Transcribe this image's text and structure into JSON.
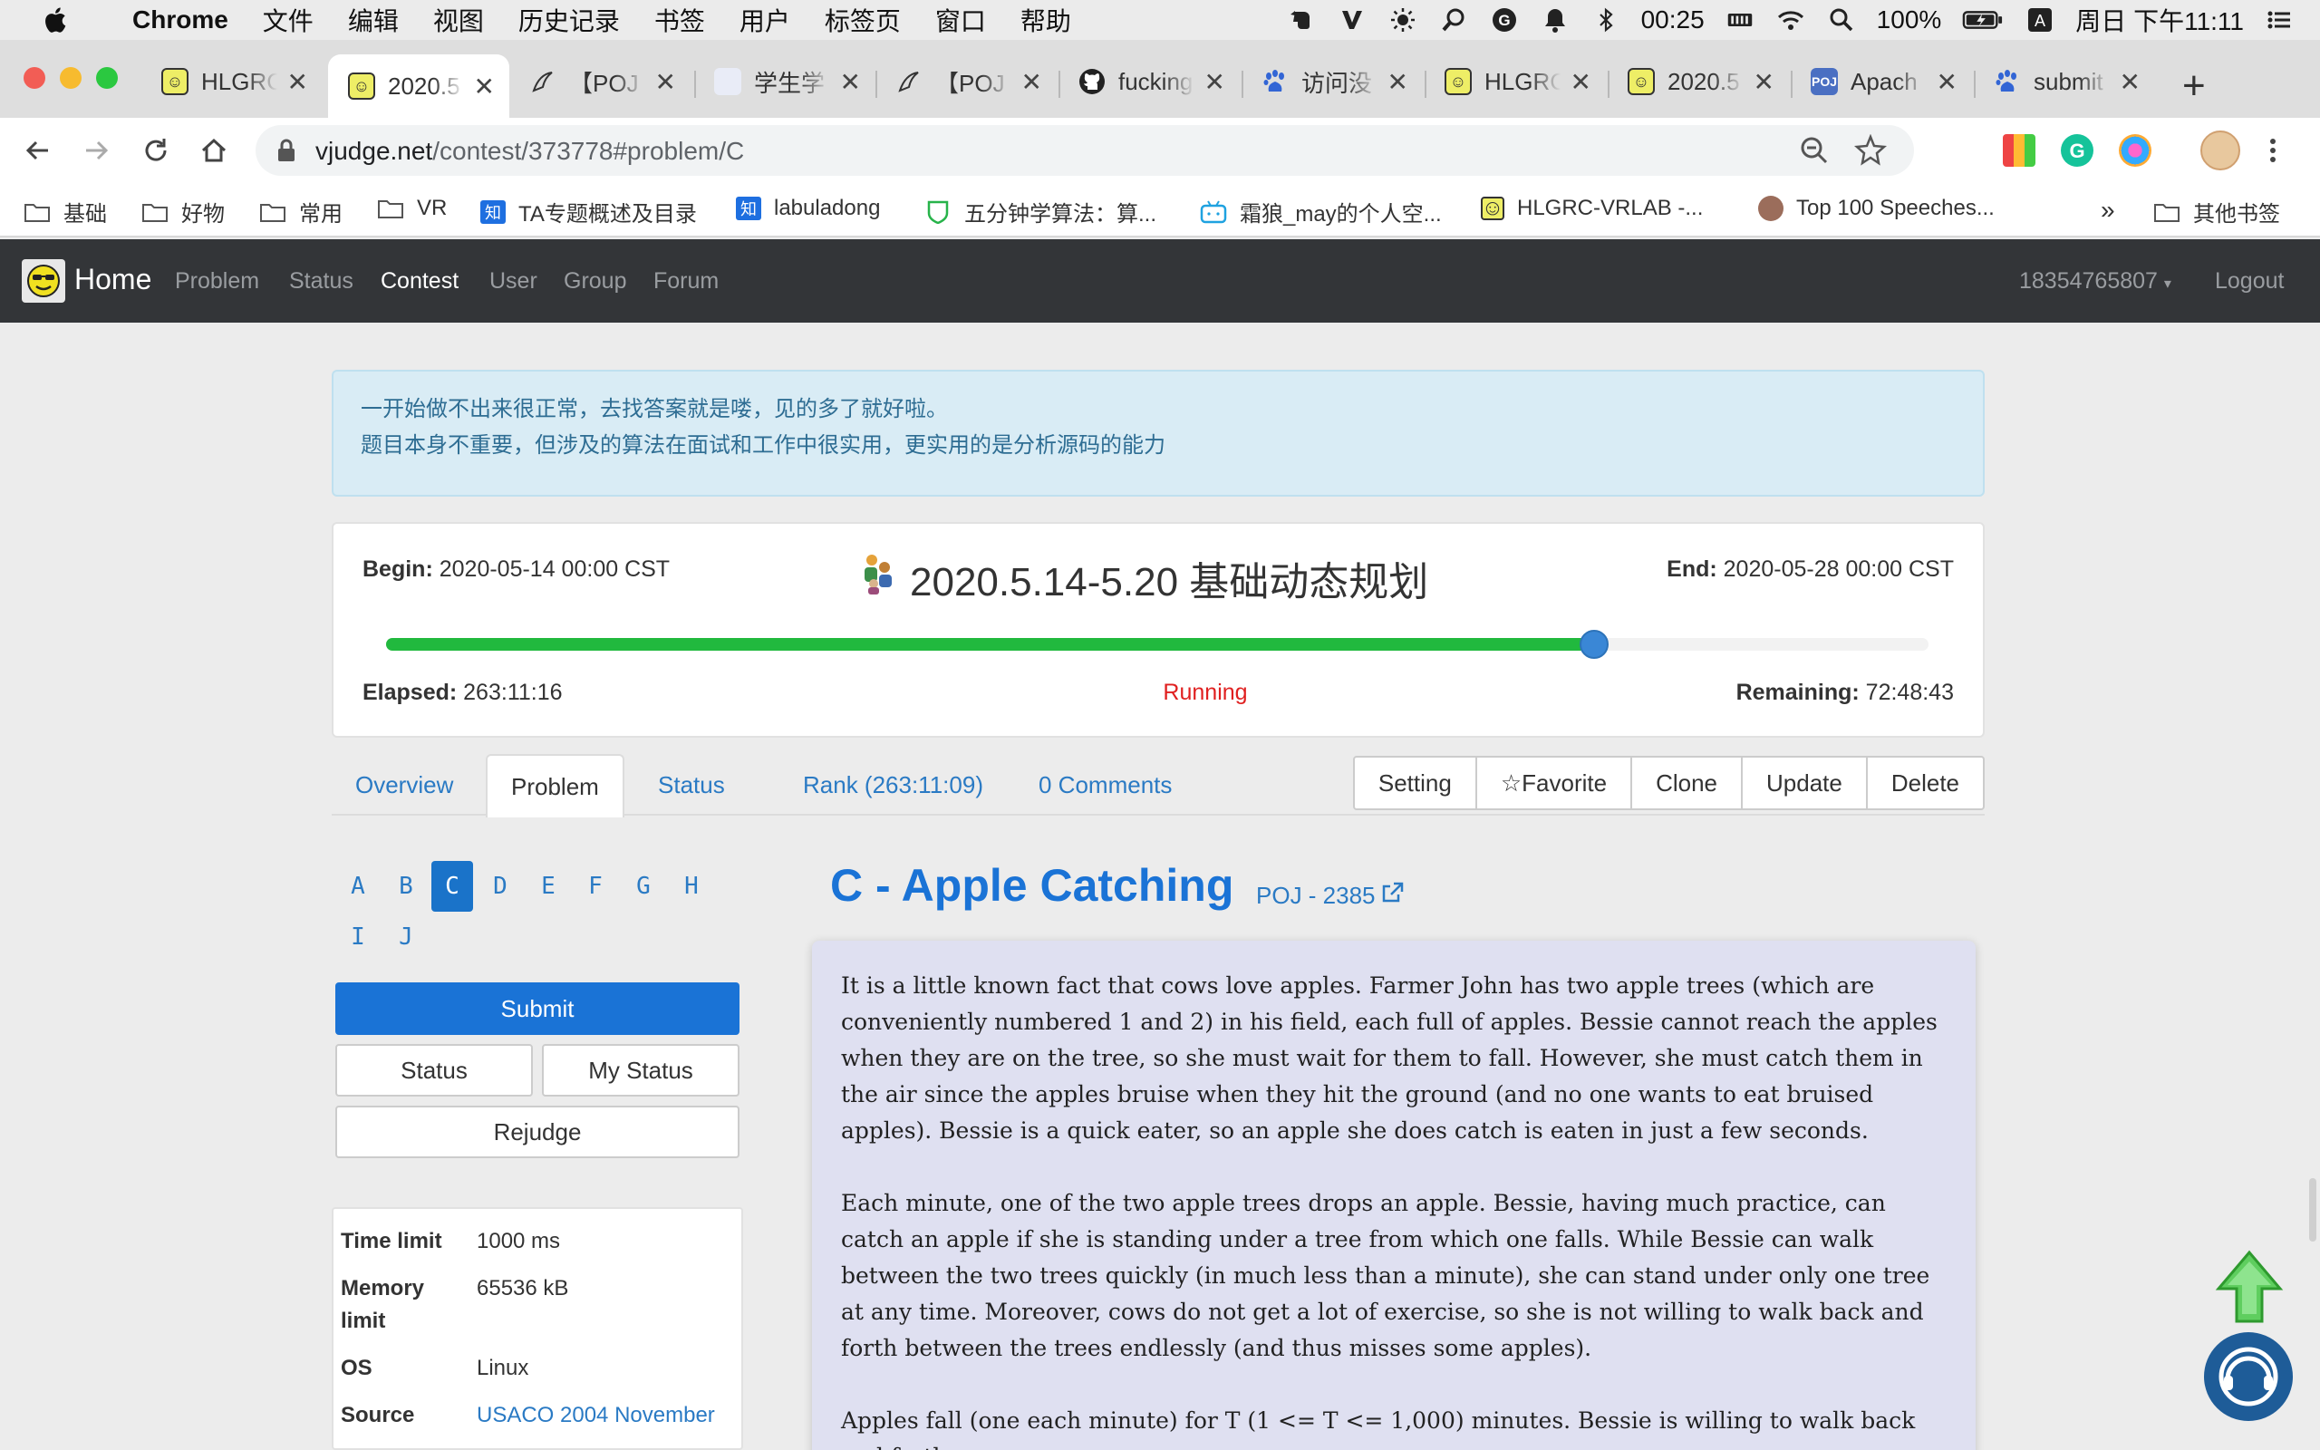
{
  "menubar": {
    "app": "Chrome",
    "items": [
      "文件",
      "编辑",
      "视图",
      "历史记录",
      "书签",
      "用户",
      "标签页",
      "窗口",
      "帮助"
    ],
    "clock": "00:25",
    "battery": "100%",
    "input_method": "A",
    "datetime": "周日 下午11:11"
  },
  "tabs": [
    {
      "title": "HLGRC",
      "fav": "smiley"
    },
    {
      "title": "2020.5",
      "fav": "smiley",
      "active": true
    },
    {
      "title": "【POJ",
      "fav": "brush"
    },
    {
      "title": "学生学",
      "fav": "blank"
    },
    {
      "title": "【POJ",
      "fav": "brush"
    },
    {
      "title": "fucking",
      "fav": "github"
    },
    {
      "title": "访问没",
      "fav": "baidu"
    },
    {
      "title": "HLGRC",
      "fav": "smiley"
    },
    {
      "title": "2020.5",
      "fav": "smiley"
    },
    {
      "title": "Apach",
      "fav": "poj"
    },
    {
      "title": "submit",
      "fav": "baidu"
    }
  ],
  "address": {
    "host": "vjudge.net",
    "path": "/contest/373778#problem/C"
  },
  "bookmarks": [
    {
      "label": "基础",
      "icon": "folder-icon"
    },
    {
      "label": "好物",
      "icon": "folder-icon"
    },
    {
      "label": "常用",
      "icon": "folder-icon"
    },
    {
      "label": "VR",
      "icon": "folder-icon"
    },
    {
      "label": "TA专题概述及目录",
      "icon": "zhihu-icon"
    },
    {
      "label": "labuladong",
      "icon": "zhihu-icon"
    },
    {
      "label": "五分钟学算法：算...",
      "icon": "shield-icon"
    },
    {
      "label": "霜狼_may的个人空...",
      "icon": "bilibili-icon"
    },
    {
      "label": "HLGRC-VRLAB -...",
      "icon": "smiley-icon"
    },
    {
      "label": "Top 100 Speeches...",
      "icon": "avatar-icon"
    }
  ],
  "bookmarks_overflow": "»",
  "bookmarks_other": "其他书签",
  "site": {
    "brand": "Home",
    "nav": [
      "Problem",
      "Status",
      "Contest",
      "User",
      "Group",
      "Forum"
    ],
    "active_nav": "Contest",
    "user": "18354765807",
    "logout": "Logout"
  },
  "notice": {
    "line1": "一开始做不出来很正常，去找答案就是喽，见的多了就好啦。",
    "line2": "题目本身不重要，但涉及的算法在面试和工作中很实用，更实用的是分析源码的能力"
  },
  "contest": {
    "begin_label": "Begin:",
    "begin": "2020-05-14 00:00 CST",
    "end_label": "End:",
    "end": "2020-05-28 00:00 CST",
    "title": "2020.5.14-5.20 基础动态规划",
    "elapsed_label": "Elapsed:",
    "elapsed": "263:11:16",
    "status": "Running",
    "remaining_label": "Remaining:",
    "remaining": "72:48:43",
    "progress": 0.783
  },
  "subtabs": {
    "overview": "Overview",
    "problem": "Problem",
    "status": "Status",
    "rank": "Rank (263:11:09)",
    "comments": "0 Comments"
  },
  "actions": [
    "Setting",
    "☆Favorite",
    "Clone",
    "Update",
    "Delete"
  ],
  "problem_letters": [
    "A",
    "B",
    "C",
    "D",
    "E",
    "F",
    "G",
    "H",
    "I",
    "J"
  ],
  "active_letter": "C",
  "buttons": {
    "submit": "Submit",
    "status": "Status",
    "my_status": "My Status",
    "rejudge": "Rejudge"
  },
  "info": {
    "time_limit_label": "Time limit",
    "time_limit": "1000 ms",
    "memory_limit_label_1": "Memory",
    "memory_limit_label_2": "limit",
    "memory_limit": "65536 kB",
    "os_label": "OS",
    "os": "Linux",
    "source_label": "Source",
    "source": "USACO 2004 November"
  },
  "problem": {
    "title": "C - Apple Catching",
    "source_link": "POJ - 2385",
    "paragraphs": [
      "It is a little known fact that cows love apples. Farmer John has two apple trees (which are conveniently numbered 1 and 2) in his field, each full of apples. Bessie cannot reach the apples when they are on the tree, so she must wait for them to fall. However, she must catch them in the air since the apples bruise when they hit the ground (and no one wants to eat bruised apples). Bessie is a quick eater, so an apple she does catch is eaten in just a few seconds.",
      "Each minute, one of the two apple trees drops an apple. Bessie, having much practice, can catch an apple if she is standing under a tree from which one falls. While Bessie can walk between the two trees quickly (in much less than a minute), she can stand under only one tree at any time. Moreover, cows do not get a lot of exercise, so she is not willing to walk back and forth between the trees endlessly (and thus misses some apples).",
      "Apples fall (one each minute) for T (1 <= T <= 1,000) minutes. Bessie is willing to walk back and forth"
    ]
  },
  "colors": {
    "accent": "#1a73d6",
    "progress": "#21b93e",
    "running": "#e02020",
    "navbar": "#333538"
  }
}
